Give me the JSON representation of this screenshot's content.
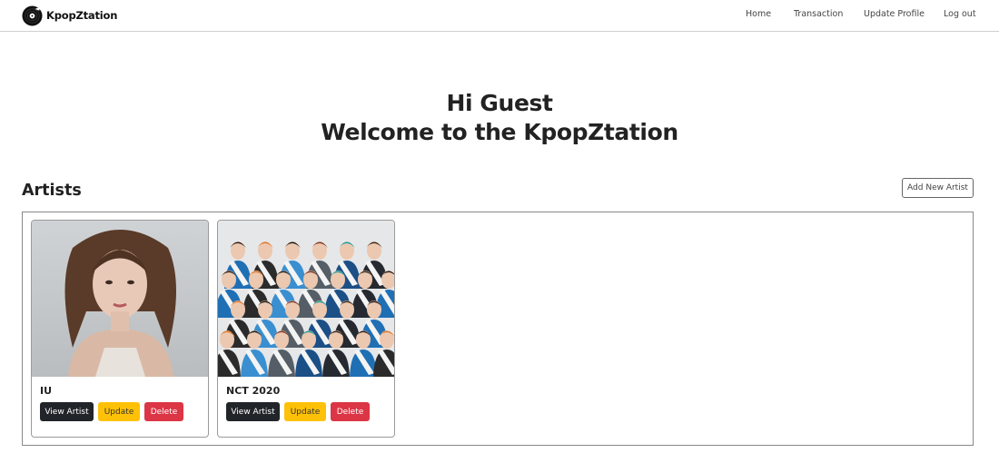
{
  "navbar": {
    "brand": "KpopZtation",
    "links": [
      "Home",
      "Transaction",
      "Update Profile",
      "Log out"
    ]
  },
  "hero": {
    "greeting": "Hi Guest",
    "welcome": "Welcome to the KpopZtation"
  },
  "artists": {
    "title": "Artists",
    "add_button": "Add New Artist",
    "cards": [
      {
        "name": "IU",
        "view": "View Artist",
        "update": "Update",
        "delete": "Delete"
      },
      {
        "name": "NCT 2020",
        "view": "View Artist",
        "update": "Update",
        "delete": "Delete"
      }
    ]
  },
  "colors": {
    "view_button": "#212529",
    "update_button": "#ffc107",
    "delete_button": "#dc3545"
  }
}
